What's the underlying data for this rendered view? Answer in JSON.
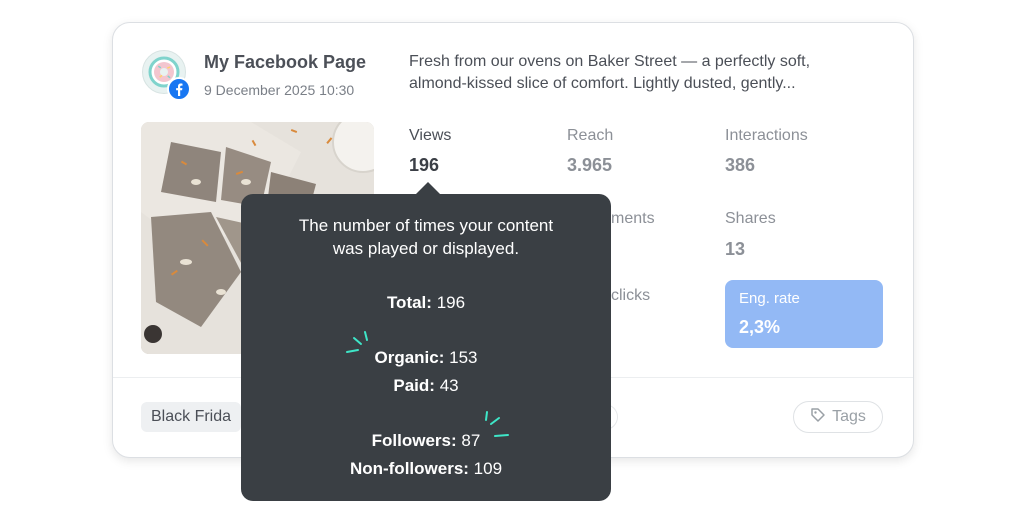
{
  "post": {
    "page_name": "My Facebook Page",
    "date": "9 December 2025 10:30",
    "text_line1": "Fresh from our ovens on Baker Street — a perfectly soft,",
    "text_line2": "almond-kissed slice of comfort. Lightly dusted, gently..."
  },
  "metrics": {
    "views": {
      "label": "Views",
      "value": "196"
    },
    "reach": {
      "label": "Reach",
      "value": "3.965"
    },
    "interactions": {
      "label": "Interactions",
      "value": "386"
    },
    "comments": {
      "label_partial": "ments"
    },
    "shares": {
      "label": "Shares",
      "value": "13"
    },
    "clicks": {
      "label_partial": "clicks"
    },
    "eng_rate": {
      "label": "Eng. rate",
      "value": "2,3%"
    }
  },
  "footer": {
    "tag_chip": "Black Frida",
    "tags_button": "Tags"
  },
  "tooltip": {
    "description_line1": "The number of times your content",
    "description_line2": "was played or displayed.",
    "total_label": "Total:",
    "total_value": "196",
    "organic_label": "Organic:",
    "organic_value": "153",
    "paid_label": "Paid:",
    "paid_value": "43",
    "followers_label": "Followers:",
    "followers_value": "87",
    "non_followers_label": "Non-followers:",
    "non_followers_value": "109"
  },
  "colors": {
    "accent_blue": "#93b9f5",
    "facebook_blue": "#1877f2",
    "tooltip_bg": "#3a3f44",
    "sparkle": "#3ee6c8"
  },
  "icons": [
    "donut-logo-icon",
    "facebook-icon",
    "tag-icon"
  ]
}
